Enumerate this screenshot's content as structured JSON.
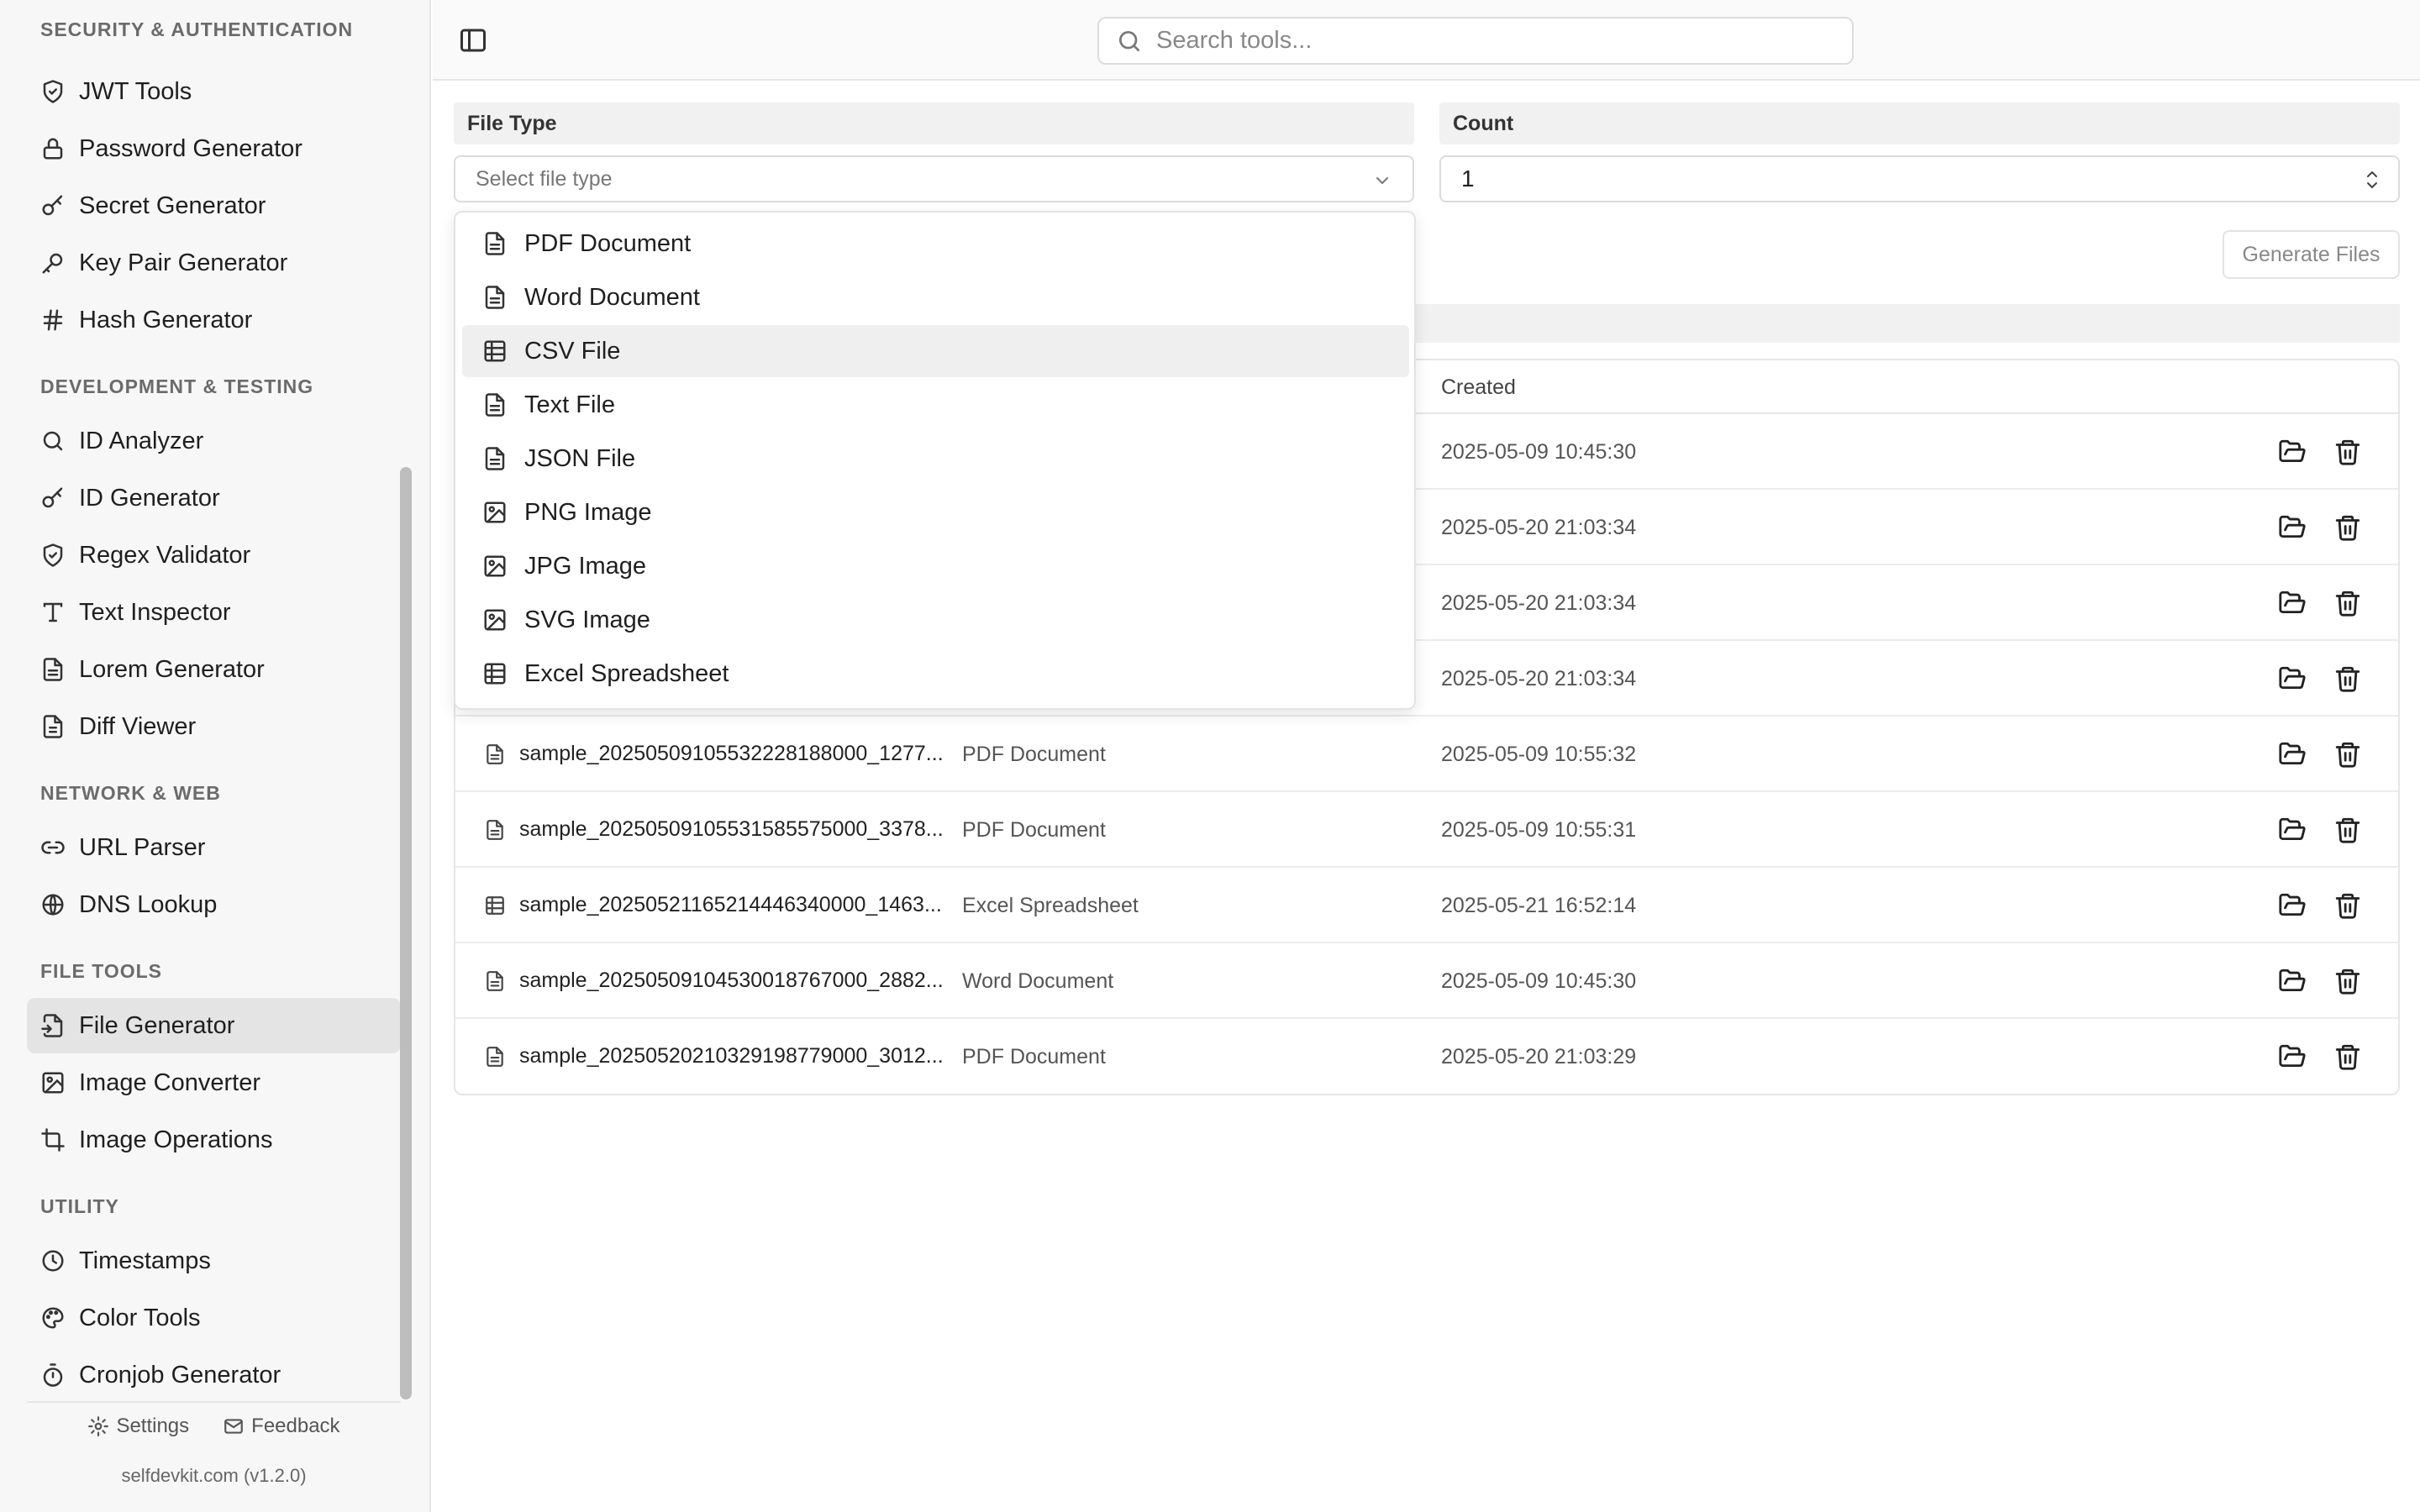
{
  "sidebar": {
    "sections": {
      "security": "Security & Authentication",
      "dev": "Development & Testing",
      "network": "Network & Web",
      "file": "File Tools",
      "utility": "Utility"
    },
    "items": {
      "jwt": "JWT Tools",
      "password": "Password Generator",
      "secret": "Secret Generator",
      "keypair": "Key Pair Generator",
      "hash": "Hash Generator",
      "id_analyzer": "ID Analyzer",
      "id_generator": "ID Generator",
      "regex": "Regex Validator",
      "text_inspector": "Text Inspector",
      "lorem": "Lorem Generator",
      "diff": "Diff Viewer",
      "url": "URL Parser",
      "dns": "DNS Lookup",
      "file_gen": "File Generator",
      "image_conv": "Image Converter",
      "image_ops": "Image Operations",
      "timestamps": "Timestamps",
      "color": "Color Tools",
      "cron": "Cronjob Generator"
    },
    "footer": {
      "settings": "Settings",
      "feedback": "Feedback",
      "version": "selfdevkit.com (v1.2.0)"
    }
  },
  "search": {
    "placeholder": "Search tools..."
  },
  "form": {
    "file_type_label": "File Type",
    "file_type_placeholder": "Select file type",
    "count_label": "Count",
    "count_value": "1",
    "generate_label": "Generate Files"
  },
  "dropdown": {
    "options": [
      {
        "label": "PDF Document",
        "icon": "file-text-icon"
      },
      {
        "label": "Word Document",
        "icon": "file-text-icon"
      },
      {
        "label": "CSV File",
        "icon": "table-icon"
      },
      {
        "label": "Text File",
        "icon": "file-text-icon"
      },
      {
        "label": "JSON File",
        "icon": "file-text-icon"
      },
      {
        "label": "PNG Image",
        "icon": "image-icon"
      },
      {
        "label": "JPG Image",
        "icon": "image-icon"
      },
      {
        "label": "SVG Image",
        "icon": "image-icon"
      },
      {
        "label": "Excel Spreadsheet",
        "icon": "table-icon"
      }
    ],
    "highlighted": "CSV File"
  },
  "table": {
    "headers": {
      "created": "Created"
    },
    "rows": [
      {
        "name": "",
        "type": "",
        "created": "2025-05-09 10:45:30"
      },
      {
        "name": "",
        "type": "",
        "created": "2025-05-20 21:03:34"
      },
      {
        "name": "",
        "type": "",
        "created": "2025-05-20 21:03:34"
      },
      {
        "name": "",
        "type": "",
        "created": "2025-05-20 21:03:34"
      },
      {
        "name": "sample_20250509105532228188000_1277...",
        "type": "PDF Document",
        "created": "2025-05-09 10:55:32"
      },
      {
        "name": "sample_20250509105531585575000_3378...",
        "type": "PDF Document",
        "created": "2025-05-09 10:55:31"
      },
      {
        "name": "sample_20250521165214446340000_1463...",
        "type": "Excel Spreadsheet",
        "created": "2025-05-21 16:52:14"
      },
      {
        "name": "sample_20250509104530018767000_2882...",
        "type": "Word Document",
        "created": "2025-05-09 10:45:30"
      },
      {
        "name": "sample_20250520210329198779000_3012...",
        "type": "PDF Document",
        "created": "2025-05-20 21:03:29"
      }
    ]
  }
}
